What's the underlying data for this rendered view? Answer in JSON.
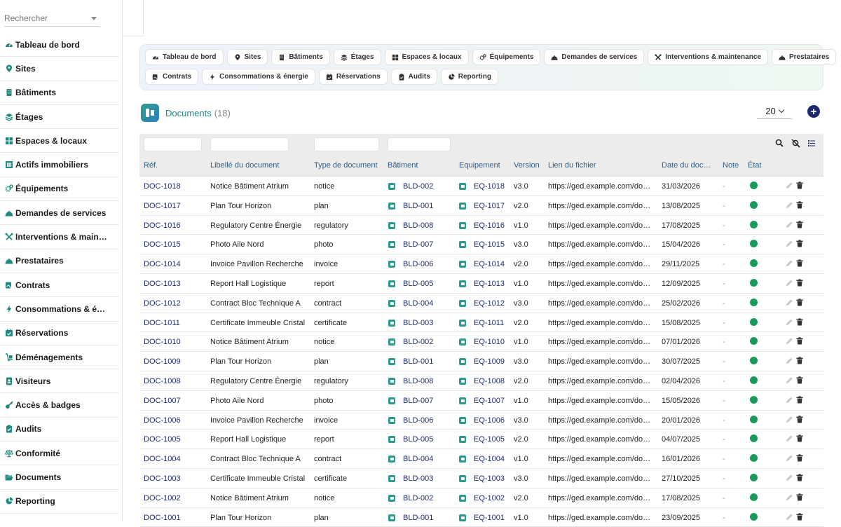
{
  "search": {
    "placeholder": "Rechercher"
  },
  "sidebar": {
    "items": [
      {
        "label": "Tableau de bord",
        "icon": "gauge-icon"
      },
      {
        "label": "Sites",
        "icon": "map-pin-icon"
      },
      {
        "label": "Bâtiments",
        "icon": "building-icon"
      },
      {
        "label": "Étages",
        "icon": "layers-icon"
      },
      {
        "label": "Espaces & locaux",
        "icon": "grid-icon"
      },
      {
        "label": "Actifs immobiliers",
        "icon": "columns-icon"
      },
      {
        "label": "Équipements",
        "icon": "gears-icon"
      },
      {
        "label": "Demandes de services",
        "icon": "bell-icon"
      },
      {
        "label": "Interventions & main…",
        "icon": "tools-icon"
      },
      {
        "label": "Prestataires",
        "icon": "bell-icon"
      },
      {
        "label": "Contrats",
        "icon": "signature-icon"
      },
      {
        "label": "Consommations & é…",
        "icon": "bolt-icon"
      },
      {
        "label": "Réservations",
        "icon": "calendar-check-icon"
      },
      {
        "label": "Déménagements",
        "icon": "dolly-icon"
      },
      {
        "label": "Visiteurs",
        "icon": "id-badge-icon"
      },
      {
        "label": "Accès & badges",
        "icon": "key-icon"
      },
      {
        "label": "Audits",
        "icon": "clipboard-check-icon"
      },
      {
        "label": "Conformité",
        "icon": "scale-icon"
      },
      {
        "label": "Documents",
        "icon": "folder-open-icon"
      },
      {
        "label": "Reporting",
        "icon": "pie-chart-icon"
      }
    ]
  },
  "nav": {
    "row1": [
      {
        "label": "Tableau de bord",
        "icon": "gauge-icon"
      },
      {
        "label": "Sites",
        "icon": "map-pin-icon"
      },
      {
        "label": "Bâtiments",
        "icon": "building-icon"
      },
      {
        "label": "Étages",
        "icon": "layers-icon"
      },
      {
        "label": "Espaces & locaux",
        "icon": "grid-icon"
      },
      {
        "label": "Équipements",
        "icon": "gears-icon"
      },
      {
        "label": "Demandes de services",
        "icon": "bell-icon"
      },
      {
        "label": "Interventions & maintenance",
        "icon": "tools-icon"
      },
      {
        "label": "Prestataires",
        "icon": "bell-icon"
      }
    ],
    "row2": [
      {
        "label": "Contrats",
        "icon": "signature-icon"
      },
      {
        "label": "Consommations & énergie",
        "icon": "bolt-icon"
      },
      {
        "label": "Réservations",
        "icon": "calendar-check-icon"
      },
      {
        "label": "Audits",
        "icon": "clipboard-check-icon"
      },
      {
        "label": "Reporting",
        "icon": "pie-chart-icon"
      }
    ]
  },
  "header": {
    "title": "Documents",
    "count": "(18)",
    "page_size": "20",
    "add_label": "+"
  },
  "table": {
    "columns": [
      "Réf.",
      "Libellé du document",
      "Type de document",
      "Bâtiment",
      "Equipement",
      "Version",
      "Lien du fichier",
      "Date du doc…",
      "Note",
      "État"
    ],
    "rows": [
      {
        "ref": "DOC-1018",
        "label": "Notice Bâtiment Atrium",
        "type": "notice",
        "bld": "BLD-002",
        "eq": "EQ-1018",
        "ver": "v3.0",
        "link": "https://ged.example.com/do…",
        "date": "31/03/2026",
        "note": "-"
      },
      {
        "ref": "DOC-1017",
        "label": "Plan Tour Horizon",
        "type": "plan",
        "bld": "BLD-001",
        "eq": "EQ-1017",
        "ver": "v2.0",
        "link": "https://ged.example.com/do…",
        "date": "13/08/2025",
        "note": "-"
      },
      {
        "ref": "DOC-1016",
        "label": "Regulatory Centre Énergie",
        "type": "regulatory",
        "bld": "BLD-008",
        "eq": "EQ-1016",
        "ver": "v1.0",
        "link": "https://ged.example.com/do…",
        "date": "17/08/2025",
        "note": "-"
      },
      {
        "ref": "DOC-1015",
        "label": "Photo Aile Nord",
        "type": "photo",
        "bld": "BLD-007",
        "eq": "EQ-1015",
        "ver": "v3.0",
        "link": "https://ged.example.com/do…",
        "date": "15/04/2026",
        "note": "-"
      },
      {
        "ref": "DOC-1014",
        "label": "Invoice Pavillon Recherche",
        "type": "invoice",
        "bld": "BLD-006",
        "eq": "EQ-1014",
        "ver": "v2.0",
        "link": "https://ged.example.com/do…",
        "date": "29/11/2025",
        "note": "-"
      },
      {
        "ref": "DOC-1013",
        "label": "Report Hall Logistique",
        "type": "report",
        "bld": "BLD-005",
        "eq": "EQ-1013",
        "ver": "v1.0",
        "link": "https://ged.example.com/do…",
        "date": "12/09/2025",
        "note": "-"
      },
      {
        "ref": "DOC-1012",
        "label": "Contract Bloc Technique A",
        "type": "contract",
        "bld": "BLD-004",
        "eq": "EQ-1012",
        "ver": "v3.0",
        "link": "https://ged.example.com/do…",
        "date": "25/02/2026",
        "note": "-"
      },
      {
        "ref": "DOC-1011",
        "label": "Certificate Immeuble Cristal",
        "type": "certificate",
        "bld": "BLD-003",
        "eq": "EQ-1011",
        "ver": "v2.0",
        "link": "https://ged.example.com/do…",
        "date": "15/08/2025",
        "note": "-"
      },
      {
        "ref": "DOC-1010",
        "label": "Notice Bâtiment Atrium",
        "type": "notice",
        "bld": "BLD-002",
        "eq": "EQ-1010",
        "ver": "v1.0",
        "link": "https://ged.example.com/do…",
        "date": "07/01/2026",
        "note": "-"
      },
      {
        "ref": "DOC-1009",
        "label": "Plan Tour Horizon",
        "type": "plan",
        "bld": "BLD-001",
        "eq": "EQ-1009",
        "ver": "v3.0",
        "link": "https://ged.example.com/do…",
        "date": "30/07/2025",
        "note": "-"
      },
      {
        "ref": "DOC-1008",
        "label": "Regulatory Centre Énergie",
        "type": "regulatory",
        "bld": "BLD-008",
        "eq": "EQ-1008",
        "ver": "v2.0",
        "link": "https://ged.example.com/do…",
        "date": "02/04/2026",
        "note": "-"
      },
      {
        "ref": "DOC-1007",
        "label": "Photo Aile Nord",
        "type": "photo",
        "bld": "BLD-007",
        "eq": "EQ-1007",
        "ver": "v1.0",
        "link": "https://ged.example.com/do…",
        "date": "15/05/2026",
        "note": "-"
      },
      {
        "ref": "DOC-1006",
        "label": "Invoice Pavillon Recherche",
        "type": "invoice",
        "bld": "BLD-006",
        "eq": "EQ-1006",
        "ver": "v3.0",
        "link": "https://ged.example.com/do…",
        "date": "20/01/2026",
        "note": "-"
      },
      {
        "ref": "DOC-1005",
        "label": "Report Hall Logistique",
        "type": "report",
        "bld": "BLD-005",
        "eq": "EQ-1005",
        "ver": "v2.0",
        "link": "https://ged.example.com/do…",
        "date": "04/07/2025",
        "note": "-"
      },
      {
        "ref": "DOC-1004",
        "label": "Contract Bloc Technique A",
        "type": "contract",
        "bld": "BLD-004",
        "eq": "EQ-1004",
        "ver": "v1.0",
        "link": "https://ged.example.com/do…",
        "date": "16/01/2026",
        "note": "-"
      },
      {
        "ref": "DOC-1003",
        "label": "Certificate Immeuble Cristal",
        "type": "certificate",
        "bld": "BLD-003",
        "eq": "EQ-1003",
        "ver": "v3.0",
        "link": "https://ged.example.com/do…",
        "date": "27/10/2025",
        "note": "-"
      },
      {
        "ref": "DOC-1002",
        "label": "Notice Bâtiment Atrium",
        "type": "notice",
        "bld": "BLD-002",
        "eq": "EQ-1002",
        "ver": "v2.0",
        "link": "https://ged.example.com/do…",
        "date": "17/08/2025",
        "note": "-"
      },
      {
        "ref": "DOC-1001",
        "label": "Plan Tour Horizon",
        "type": "plan",
        "bld": "BLD-001",
        "eq": "EQ-1001",
        "ver": "v1.0",
        "link": "https://ged.example.com/do…",
        "date": "23/09/2025",
        "note": "-"
      }
    ]
  },
  "colors": {
    "accent": "#1f8a83",
    "link": "#1e2a6b",
    "status_ok": "#1a9a5a",
    "chip": "#2b9a8e"
  }
}
